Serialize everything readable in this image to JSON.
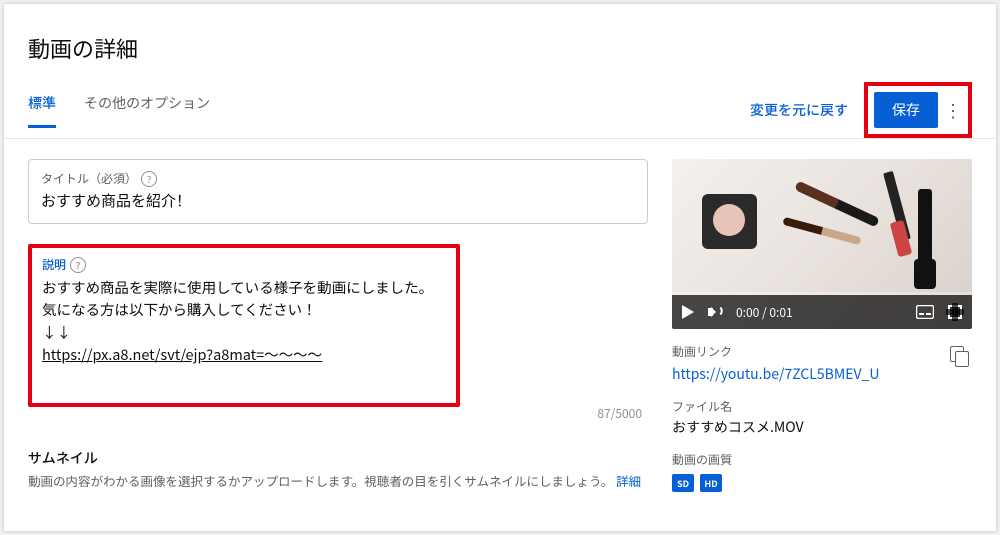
{
  "page_title": "動画の詳細",
  "tabs": {
    "standard": "標準",
    "other": "その他のオプション"
  },
  "actions": {
    "revert": "変更を元に戻す",
    "save": "保存"
  },
  "title_field": {
    "label": "タイトル（必須）",
    "value": "おすすめ商品を紹介！"
  },
  "description_field": {
    "label": "説明",
    "value_line1": "おすすめ商品を実際に使用している様子を動画にしました。",
    "value_line2": "気になる方は以下から購入してください！",
    "value_line3": "↓↓",
    "value_line4": "https://px.a8.net/svt/ejp?a8mat=～～～～",
    "counter": "87/5000"
  },
  "thumbnail": {
    "title": "サムネイル",
    "desc": "動画の内容がわかる画像を選択するかアップロードします。視聴者の目を引くサムネイルにしましょう。",
    "more": "詳細"
  },
  "player": {
    "time": "0:00 / 0:01"
  },
  "meta": {
    "link_label": "動画リンク",
    "link_url": "https://youtu.be/7ZCL5BMEV_U",
    "file_label": "ファイル名",
    "file_name": "おすすめコスメ.MOV",
    "quality_label": "動画の画質",
    "sd": "SD",
    "hd": "HD"
  }
}
